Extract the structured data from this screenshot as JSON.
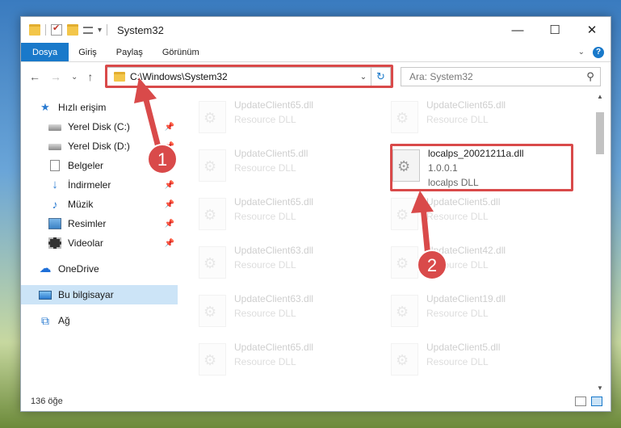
{
  "window": {
    "title": "System32"
  },
  "titlebar": {
    "minimize": "—",
    "maximize": "☐",
    "close": "✕",
    "customize_glyph": "▾"
  },
  "ribbon": {
    "tabs": [
      "Dosya",
      "Giriş",
      "Paylaş",
      "Görünüm"
    ],
    "expand_glyph": "⌄",
    "help_glyph": "?"
  },
  "nav": {
    "back": "←",
    "forward": "→",
    "recent": "⌄",
    "up": "↑"
  },
  "address": {
    "path": "C:\\Windows\\System32",
    "dropdown": "⌄",
    "refresh": "↻"
  },
  "search": {
    "placeholder": "Ara: System32",
    "icon": "⚲"
  },
  "sidebar": {
    "quick_access": "Hızlı erişim",
    "items": [
      {
        "label": "Yerel Disk (C:)",
        "icon": "disk-icon",
        "pinned": true
      },
      {
        "label": "Yerel Disk (D:)",
        "icon": "disk-icon",
        "pinned": true
      },
      {
        "label": "Belgeler",
        "icon": "document-icon",
        "pinned": true
      },
      {
        "label": "İndirmeler",
        "icon": "download-icon",
        "pinned": true
      },
      {
        "label": "Müzik",
        "icon": "music-icon",
        "pinned": true
      },
      {
        "label": "Resimler",
        "icon": "pictures-icon",
        "pinned": true
      },
      {
        "label": "Videolar",
        "icon": "video-icon",
        "pinned": true
      }
    ],
    "pin_glyph": "📌",
    "onedrive": "OneDrive",
    "this_pc": "Bu bilgisayar",
    "network": "Ağ"
  },
  "files": {
    "left": [
      {
        "name": "UpdateClient65.dll",
        "desc": "Resource DLL"
      },
      {
        "name": "UpdateClient5.dll",
        "desc": "Resource DLL"
      },
      {
        "name": "UpdateClient65.dll",
        "desc": "Resource DLL"
      },
      {
        "name": "UpdateClient63.dll",
        "desc": "Resource DLL"
      },
      {
        "name": "UpdateClient63.dll",
        "desc": "Resource DLL"
      },
      {
        "name": "UpdateClient65.dll",
        "desc": "Resource DLL"
      }
    ],
    "right": [
      {
        "name": "UpdateClient65.dll",
        "desc": "Resource DLL"
      },
      {
        "name": "UpdateClient5.dll",
        "desc": "Resource DLL"
      },
      {
        "name": "UpdateClient42.dll",
        "desc": "Resource DLL"
      },
      {
        "name": "UpdateClient19.dll",
        "desc": "Resource DLL"
      },
      {
        "name": "UpdateClient5.dll",
        "desc": "Resource DLL"
      }
    ],
    "highlighted": {
      "name": "localps_20021211a.dll",
      "version": "1.0.0.1",
      "desc": "localps DLL"
    }
  },
  "status": {
    "count": "136 öğe"
  },
  "annotations": {
    "step1": "1",
    "step2": "2",
    "color": "#d94a4a"
  }
}
